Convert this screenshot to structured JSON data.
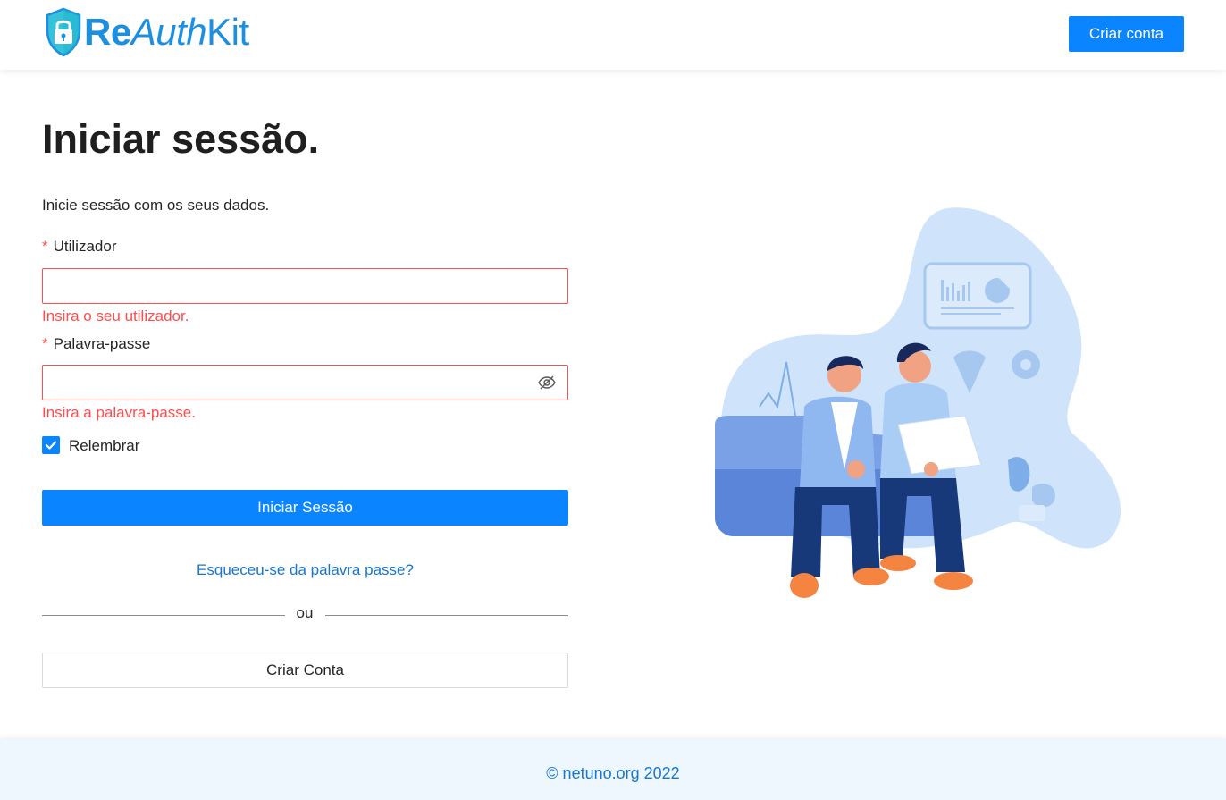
{
  "header": {
    "logo": {
      "part1": "Re",
      "part2": "Auth",
      "part3": "Kit"
    },
    "create_account_label": "Criar conta"
  },
  "login": {
    "title": "Iniciar sessão.",
    "subtitle": "Inicie sessão com os seus dados.",
    "required_marker": "*",
    "username": {
      "label": "Utilizador",
      "value": "",
      "error": "Insira o seu utilizador."
    },
    "password": {
      "label": "Palavra-passe",
      "value": "",
      "error": "Insira a palavra-passe."
    },
    "remember": {
      "label": "Relembrar",
      "checked": true
    },
    "submit_label": "Iniciar Sessão",
    "forgot_link": "Esqueceu-se da palavra passe?",
    "divider_text": "ou",
    "create_account_label": "Criar Conta"
  },
  "footer": {
    "text": "© netuno.org 2022"
  },
  "colors": {
    "primary": "#0a84ff",
    "error": "#ff4d4f",
    "link": "#1677d2",
    "footer_bg": "#eef7fe"
  },
  "icons": {
    "logo": "shield-lock-icon",
    "password_toggle": "eye-off-icon",
    "checkbox": "check-icon"
  }
}
